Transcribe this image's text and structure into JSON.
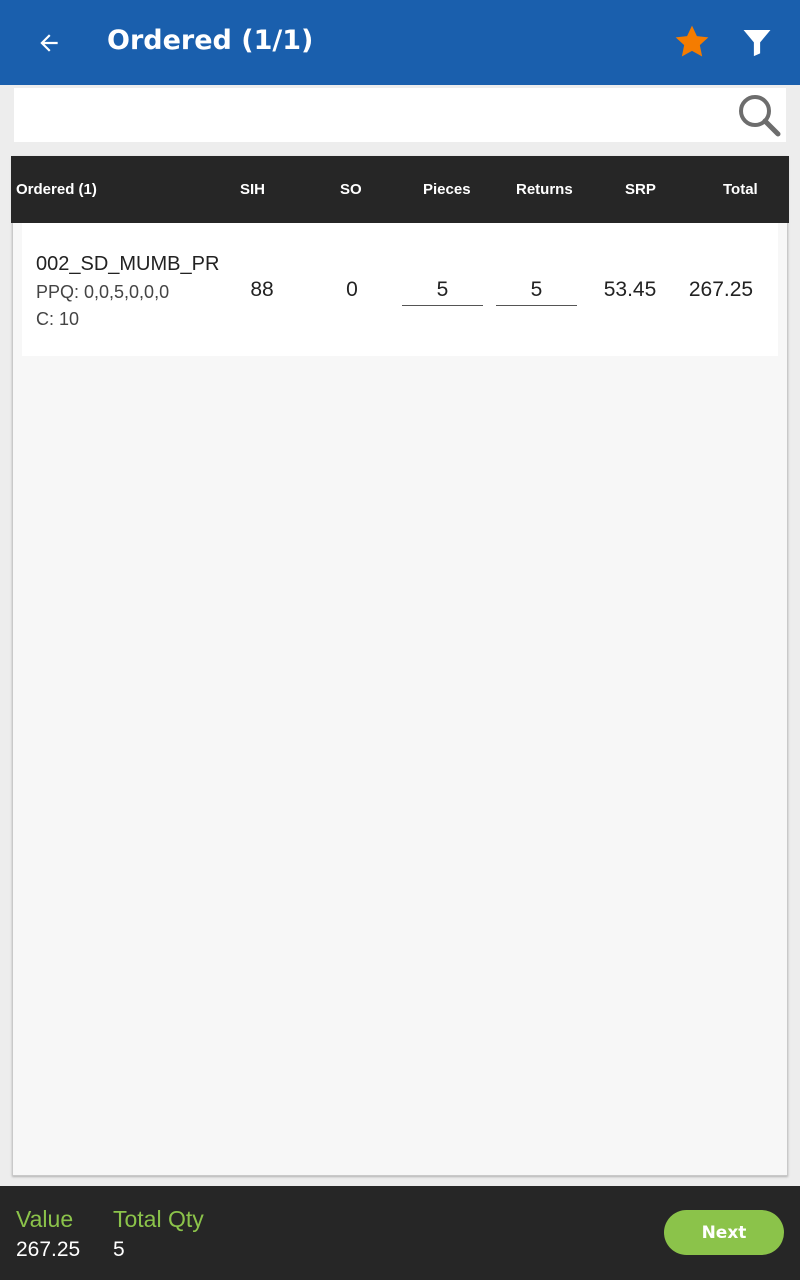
{
  "appbar": {
    "title": "Ordered (1/1)",
    "icons": {
      "back": "arrow-back-icon",
      "favorite": "star-icon",
      "filter": "filter-icon"
    },
    "star_color": "#f57c00",
    "bar_color": "#1a5fad"
  },
  "search": {
    "value": "",
    "placeholder": "",
    "icon": "search-icon"
  },
  "table": {
    "headers": [
      "Ordered (1)",
      "SIH",
      "SO",
      "Pieces",
      "Returns",
      "SRP",
      "Total"
    ],
    "rows": [
      {
        "name": "002_SD_MUMB_PR",
        "ppq": "PPQ: 0,0,5,0,0,0",
        "c": "C: 10",
        "sih": "88",
        "so": "0",
        "pieces": "5",
        "returns": "5",
        "srp": "53.45",
        "total": "267.25"
      }
    ]
  },
  "footer": {
    "value_label": "Value",
    "value": "267.25",
    "qty_label": "Total Qty",
    "qty": "5",
    "next_label": "Next",
    "accent": "#8bc34a"
  }
}
